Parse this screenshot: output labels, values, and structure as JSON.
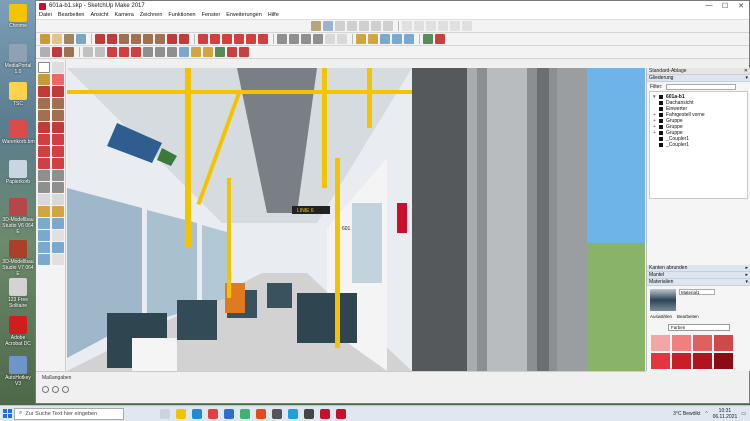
{
  "desktop_icons": [
    {
      "label": "Chrome",
      "color": "#f5c400"
    },
    {
      "label": "MediaPortal 1.0",
      "color": "#8fa2b3"
    },
    {
      "label": "TSC",
      "color": "#ffd24d"
    },
    {
      "label": "Warenkorb.bmp",
      "color": "#d94c4c"
    },
    {
      "label": "Papierkorb",
      "color": "#c9d6e2"
    },
    {
      "label": "3D-Modellbau Studio V6 064 E",
      "color": "#b44848"
    },
    {
      "label": "3D-Modellbau Studio V7 064 E",
      "color": "#a8402a"
    },
    {
      "label": "123 Free Solitaire",
      "color": "#d3d3d3"
    },
    {
      "label": "Adobe Acrobat DC",
      "color": "#d21d1d"
    },
    {
      "label": "AutoHotkey V3",
      "color": "#6d95c8"
    }
  ],
  "window": {
    "title": "601a-b1.skp - SketchUp Make 2017",
    "controls": {
      "minimize": "—",
      "maximize": "☐",
      "close": "✕"
    }
  },
  "menu": [
    "Datei",
    "Bearbeiten",
    "Ansicht",
    "Kamera",
    "Zeichnen",
    "Funktionen",
    "Fenster",
    "Erweiterungen",
    "Hilfe"
  ],
  "status": {
    "measure_label": "Maßangaben"
  },
  "viewport": {
    "sign_text": "LINIE 6",
    "door_number": "601"
  },
  "panel": {
    "title": "Standard-Ablage",
    "close": "✕",
    "trays": {
      "outliner": "Gliederung",
      "edges": "Kanten abrunden",
      "entities": "Mantel",
      "materials": "Materialien"
    },
    "filter_label": "Filter:",
    "outliner_root": "601a-b1",
    "outliner_items": [
      {
        "label": "Dachansicht",
        "has_children": false
      },
      {
        "label": "Einwerter",
        "has_children": false
      },
      {
        "label": "Fahrgestell vorne",
        "has_children": true
      },
      {
        "label": "Gruppe",
        "has_children": true
      },
      {
        "label": "Gruppe",
        "has_children": true
      },
      {
        "label": "Gruppe",
        "has_children": true
      },
      {
        "label": "_Coupler1",
        "has_children": false
      },
      {
        "label": "_Coupler1",
        "has_children": false
      }
    ],
    "material_name": "Material1",
    "material_tabs": [
      "Auswählen",
      "Bearbeiten"
    ],
    "material_set": "Farben",
    "swatches": [
      "#f2a7a7",
      "#f08080",
      "#e06060",
      "#d04848",
      "#e3353c",
      "#c81e28",
      "#b0141c",
      "#8c0c14"
    ]
  },
  "taskbar": {
    "search_placeholder": "Zur Suche Text hier eingeben",
    "weather": "3°C Bewölkt",
    "time": "10:31",
    "date": "06.11.2021"
  }
}
